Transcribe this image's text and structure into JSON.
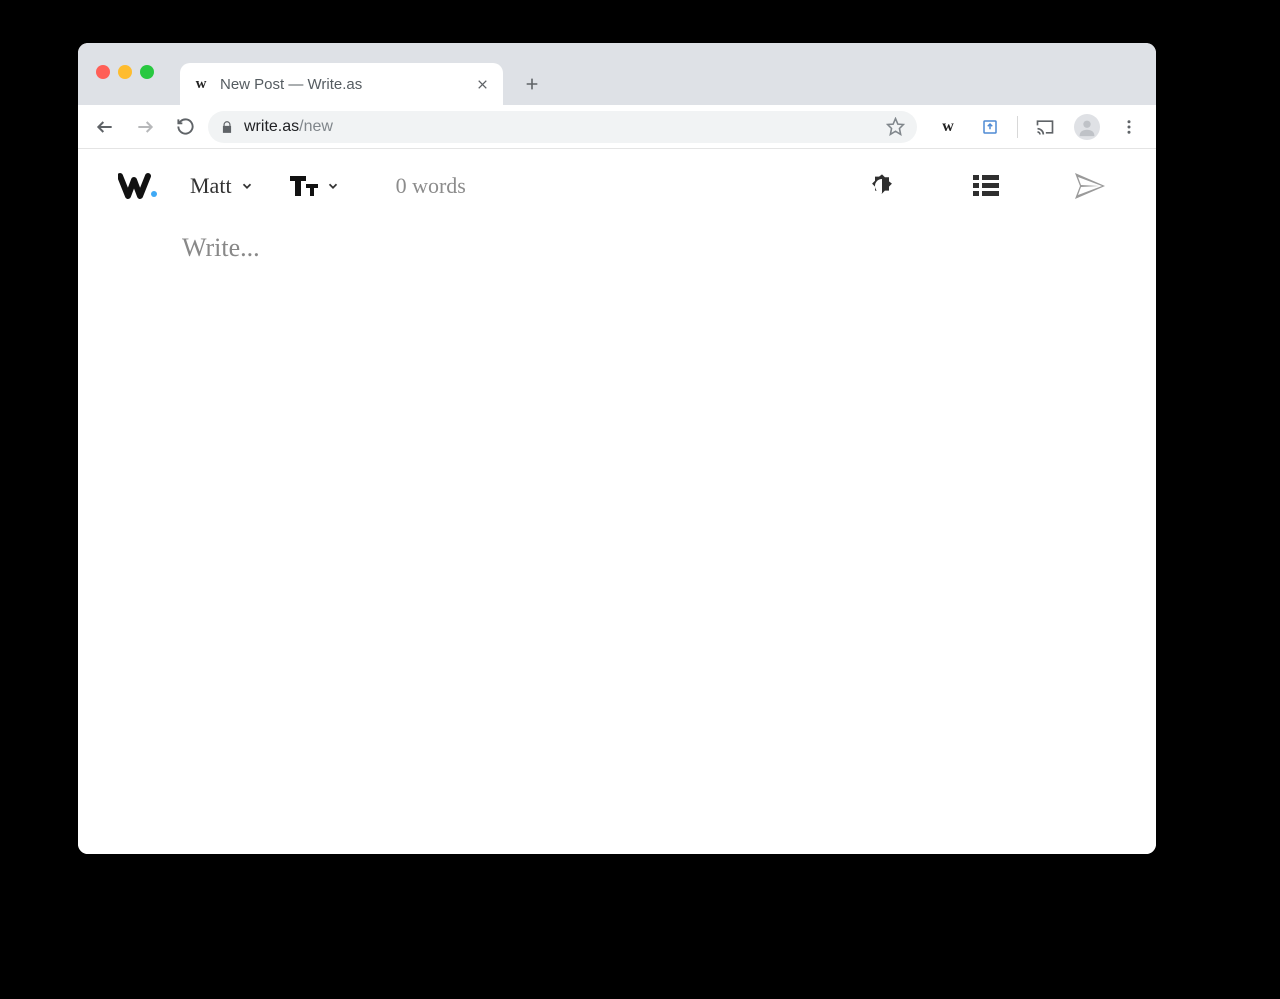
{
  "browser": {
    "tab_title": "New Post — Write.as",
    "favicon_letter": "w",
    "url_host": "write.as",
    "url_path": "/new",
    "extension_letter": "w"
  },
  "app": {
    "blog_selector_label": "Matt",
    "word_count_text": "0 words",
    "editor_value": "",
    "editor_placeholder": "Write..."
  }
}
